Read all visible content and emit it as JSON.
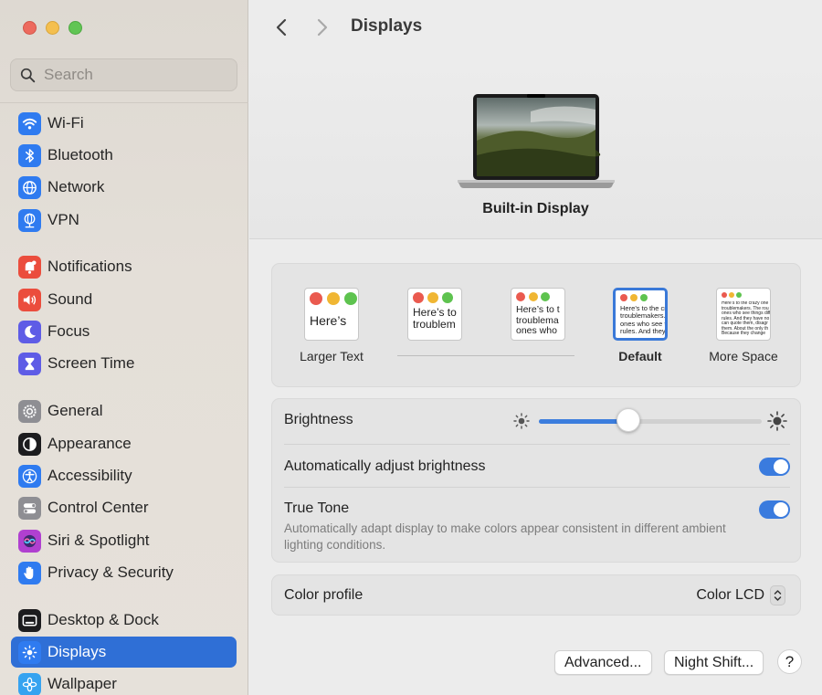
{
  "window": {
    "title": "Displays"
  },
  "search": {
    "placeholder": "Search"
  },
  "sidebar": {
    "items": [
      {
        "label": "Wi-Fi",
        "icon": "wifi-icon",
        "color": "#2f7bf0"
      },
      {
        "label": "Bluetooth",
        "icon": "bluetooth-icon",
        "color": "#2f7bf0"
      },
      {
        "label": "Network",
        "icon": "globe-icon",
        "color": "#2f7bf0"
      },
      {
        "label": "VPN",
        "icon": "vpn-globe-icon",
        "color": "#2f7bf0"
      },
      {
        "label": "Notifications",
        "icon": "bell-icon",
        "color": "#eb4d3d"
      },
      {
        "label": "Sound",
        "icon": "speaker-icon",
        "color": "#eb4d3d"
      },
      {
        "label": "Focus",
        "icon": "moon-icon",
        "color": "#5e5ce6"
      },
      {
        "label": "Screen Time",
        "icon": "hourglass-icon",
        "color": "#5e5ce6"
      },
      {
        "label": "General",
        "icon": "gear-icon",
        "color": "#8e8e93"
      },
      {
        "label": "Appearance",
        "icon": "appearance-icon",
        "color": "#1c1c1e"
      },
      {
        "label": "Accessibility",
        "icon": "accessibility-icon",
        "color": "#2f7bf0"
      },
      {
        "label": "Control Center",
        "icon": "toggles-icon",
        "color": "#8e8e93"
      },
      {
        "label": "Siri & Spotlight",
        "icon": "siri-icon",
        "color": "#b040d0"
      },
      {
        "label": "Privacy & Security",
        "icon": "hand-icon",
        "color": "#2f7bf0"
      },
      {
        "label": "Desktop & Dock",
        "icon": "dock-icon",
        "color": "#1c1c1e"
      },
      {
        "label": "Displays",
        "icon": "sun-icon",
        "color": "#2f7bf0"
      },
      {
        "label": "Wallpaper",
        "icon": "flower-icon",
        "color": "#36a3f0"
      }
    ],
    "active": "Displays"
  },
  "display": {
    "name": "Built-in Display"
  },
  "resolution": {
    "options": [
      {
        "label": "Larger Text",
        "preview": "Here’s"
      },
      {
        "label": "",
        "preview": "Here’s to\ntroublem"
      },
      {
        "label": "",
        "preview": "Here’s to t\ntroublema\nones who"
      },
      {
        "label": "Default",
        "preview": "Here’s to the cr\ntroublemakers. T\nones who see t\nrules. And they"
      },
      {
        "label": "More Space",
        "preview": "Here’s to the crazy one\ntroublemakers. The rou\nones who see things diff\nrules. And they have no\ncan quote them, disagr\nthem. About the only th\nBecause they change"
      }
    ],
    "selected": "Default"
  },
  "brightness": {
    "label": "Brightness",
    "level_percent": 40
  },
  "auto_brightness": {
    "label": "Automatically adjust brightness",
    "on": true
  },
  "true_tone": {
    "label": "True Tone",
    "on": true,
    "description": "Automatically adapt display to make colors appear consistent in different ambient lighting conditions."
  },
  "color_profile": {
    "label": "Color profile",
    "value": "Color LCD"
  },
  "buttons": {
    "advanced": "Advanced...",
    "night_shift": "Night Shift...",
    "help": "?"
  },
  "colors": {
    "accent": "#2f6fd6",
    "toggle_on": "#3a7bde"
  }
}
